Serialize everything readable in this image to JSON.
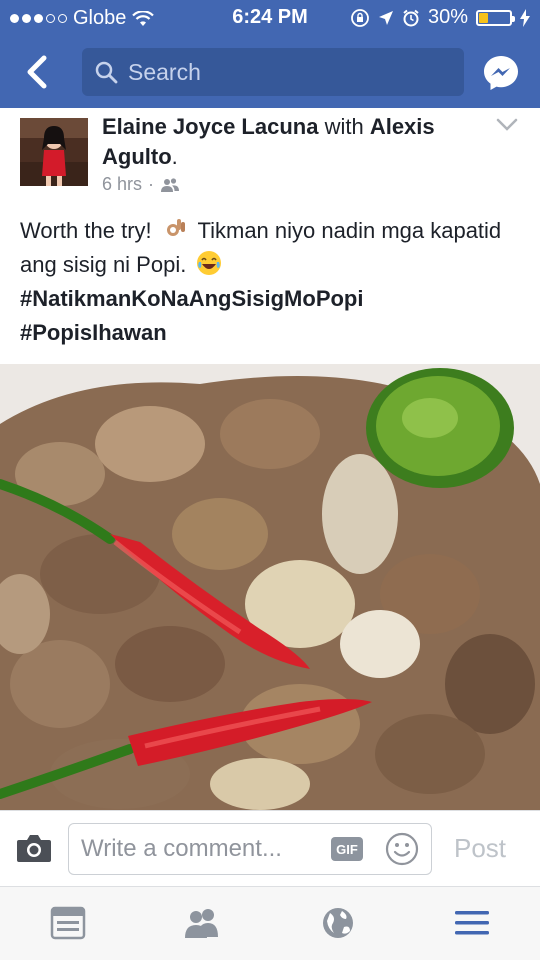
{
  "status_bar": {
    "carrier": "Globe",
    "time": "6:24 PM",
    "battery": "30%",
    "battery_level": 0.3
  },
  "nav": {
    "search_placeholder": "Search"
  },
  "post": {
    "author": "Elaine Joyce Lacuna",
    "with_word": "with",
    "tagged": "Alexis Agulto",
    "time_ago": "6 hrs",
    "text_line1": "Worth the try!",
    "text_line1b": "Tikman niyo nadin mga kapatid ang sisig ni Popi.",
    "hashtag1": "#NatikmanKoNaAngSisigMoPopi",
    "hashtag2": "#PopisIhawan"
  },
  "comment_bar": {
    "placeholder": "Write a comment...",
    "gif_label": "GIF",
    "post_label": "Post"
  },
  "colors": {
    "brand_blue": "#4267b2",
    "search_bg": "#365899"
  }
}
